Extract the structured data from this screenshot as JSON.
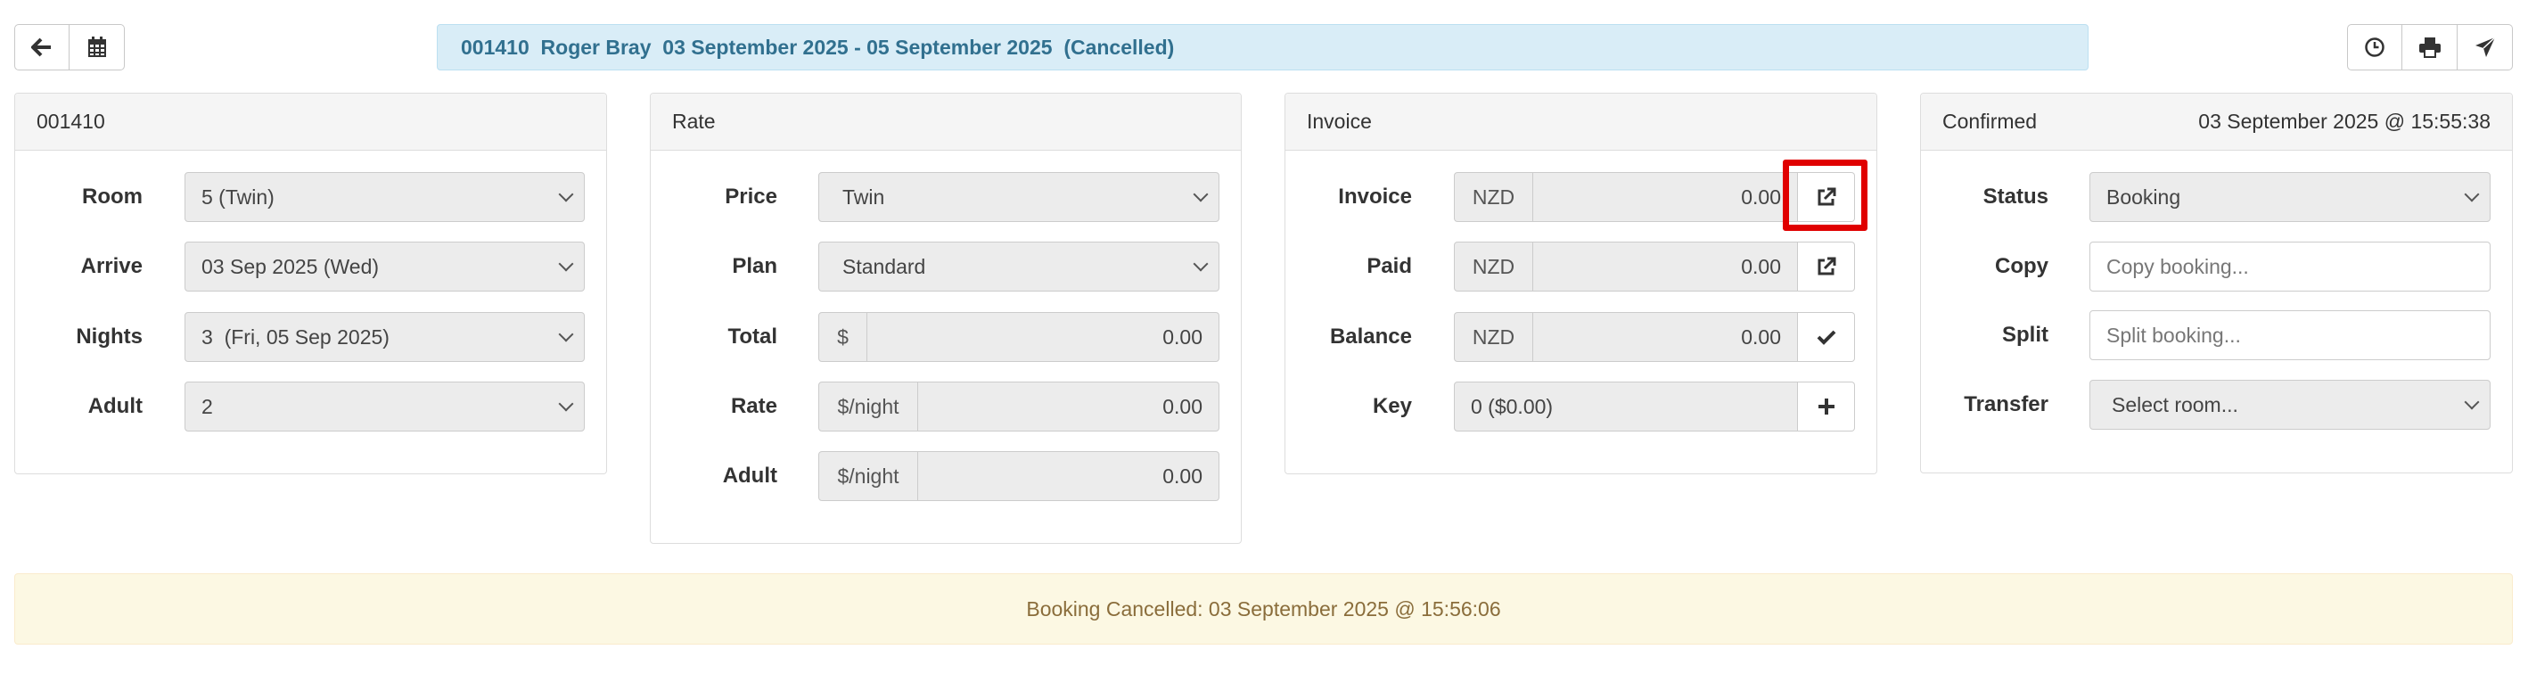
{
  "toolbar": {
    "left_buttons": [
      "back-arrow-icon",
      "calendar-icon"
    ],
    "right_buttons": [
      "history-clock-icon",
      "print-icon",
      "send-icon"
    ]
  },
  "banner": {
    "text": "001410  Roger Bray  03 September 2025 - 05 September 2025  (Cancelled)"
  },
  "booking_panel": {
    "heading": "001410",
    "rows": [
      {
        "label": "Room",
        "value": "5 (Twin)"
      },
      {
        "label": "Arrive",
        "value": "03 Sep 2025 (Wed)"
      },
      {
        "label": "Nights",
        "value": "3  (Fri, 05 Sep 2025)"
      },
      {
        "label": "Adult",
        "value": "2"
      }
    ]
  },
  "rate_panel": {
    "heading": "Rate",
    "price_label": "Price",
    "price_value": "Twin",
    "plan_label": "Plan",
    "plan_value": "Standard",
    "total_label": "Total",
    "total_addon": "$",
    "total_value": "0.00",
    "rate_label": "Rate",
    "rate_addon": "$/night",
    "rate_value": "0.00",
    "adult_label": "Adult",
    "adult_addon": "$/night",
    "adult_value": "0.00"
  },
  "invoice_panel": {
    "heading": "Invoice",
    "invoice_label": "Invoice",
    "invoice_currency": "NZD",
    "invoice_value": "0.00",
    "paid_label": "Paid",
    "paid_currency": "NZD",
    "paid_value": "0.00",
    "balance_label": "Balance",
    "balance_currency": "NZD",
    "balance_value": "0.00",
    "key_label": "Key",
    "key_value": "0 ($0.00)"
  },
  "status_panel": {
    "heading": "Confirmed",
    "timestamp": "03 September 2025 @ 15:55:38",
    "status_label": "Status",
    "status_value": "Booking",
    "copy_label": "Copy",
    "copy_placeholder": "Copy booking...",
    "split_label": "Split",
    "split_placeholder": "Split booking...",
    "transfer_label": "Transfer",
    "transfer_value": "Select room..."
  },
  "alert": {
    "text": "Booking Cancelled: 03 September 2025 @ 15:56:06"
  },
  "colors": {
    "banner_bg": "#d9edf7",
    "banner_text": "#31708f",
    "alert_bg": "#fcf8e3",
    "alert_text": "#8a6d3b",
    "highlight": "#e00000"
  }
}
